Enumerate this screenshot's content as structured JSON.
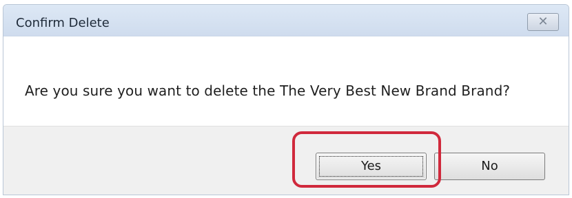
{
  "dialog": {
    "title": "Confirm Delete",
    "close_glyph": "✕",
    "message": "Are you sure you want to delete the The Very Best New Brand Brand?",
    "buttons": {
      "yes_label": "Yes",
      "no_label": "No"
    }
  },
  "annotation": {
    "highlight_color": "#d0293c",
    "target": "yes-button"
  },
  "colors": {
    "titlebar": "#cfdcee",
    "footer": "#f0f0f0"
  }
}
